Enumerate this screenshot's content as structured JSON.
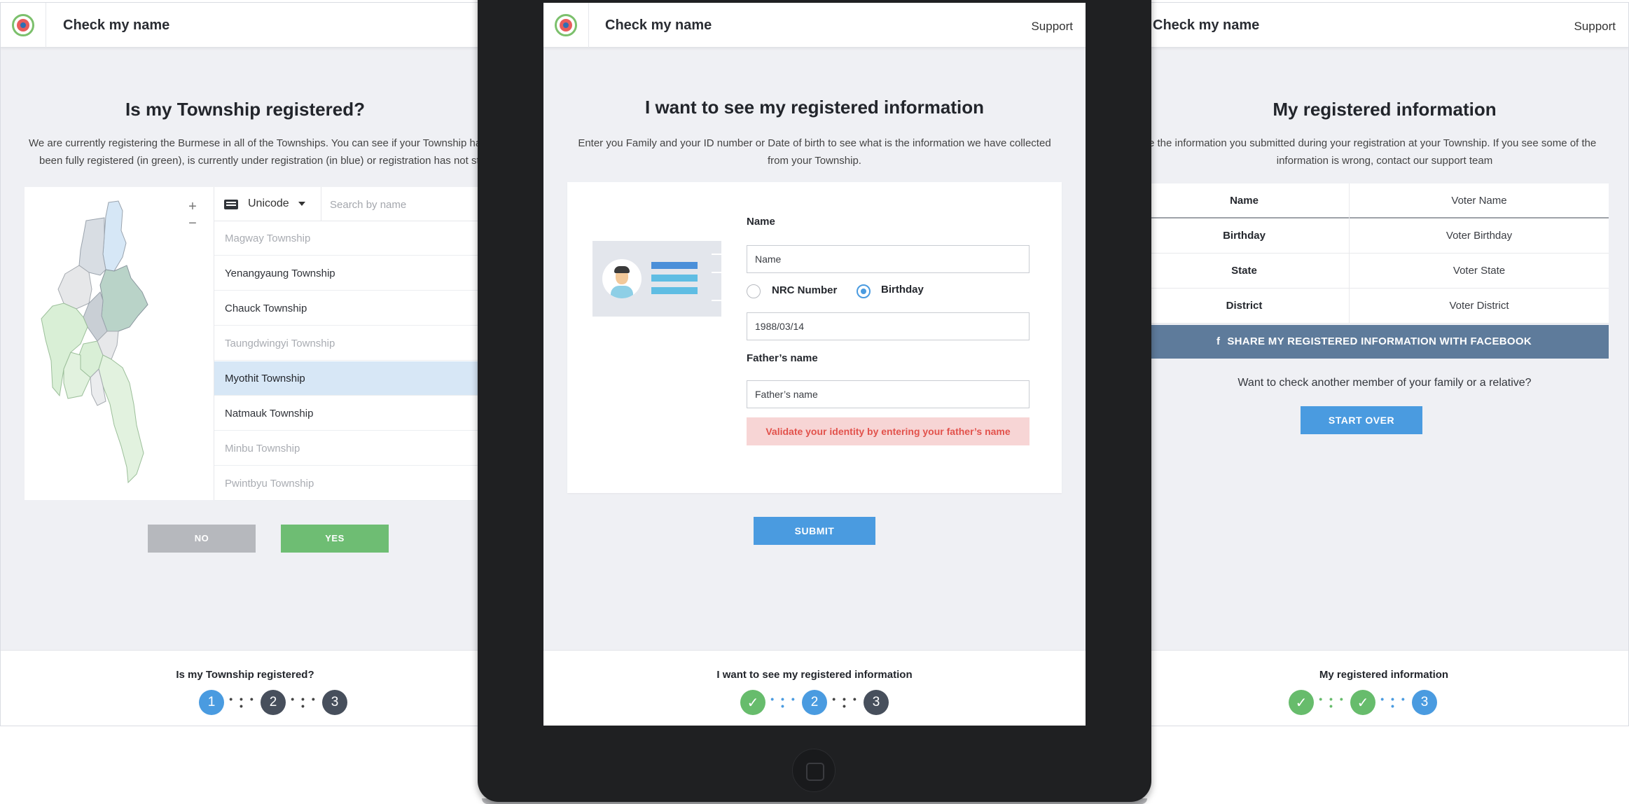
{
  "app": {
    "title": "Check my name",
    "support": "Support"
  },
  "screen1": {
    "heading": "Is my Township registered?",
    "description_line1": "We are currently registering the Burmese in all of the Townships. You can see if your Township has",
    "description_line2": "been fully registered (in green), is currently under registration (in blue) or registration has not star",
    "keyboard_icon": "keyboard-icon",
    "keyboard_select": "Unicode",
    "search_placeholder": "Search by name",
    "zoom_in": "+",
    "zoom_out": "−",
    "townships": [
      {
        "name": "Magway Township",
        "state": "muted"
      },
      {
        "name": "Yenangyaung Township",
        "state": "normal"
      },
      {
        "name": "Chauck Township",
        "state": "normal"
      },
      {
        "name": "Taungdwingyi Township",
        "state": "muted"
      },
      {
        "name": "Myothit Township",
        "state": "selected"
      },
      {
        "name": "Natmauk Township",
        "state": "normal"
      },
      {
        "name": "Minbu Township",
        "state": "muted"
      },
      {
        "name": "Pwintbyu Township",
        "state": "muted"
      }
    ],
    "no_label": "NO",
    "yes_label": "YES",
    "footer_title": "Is my Township registered?",
    "steps": [
      "1",
      "2",
      "3"
    ]
  },
  "screen2": {
    "heading": "I want to see my registered information",
    "description_line1": "Enter you Family and your ID number or Date of birth to see what is the information we have collected",
    "description_line2": "from your Township.",
    "name_label": "Name",
    "name_placeholder": "Name",
    "radio_nrc": "NRC Number",
    "radio_birthday": "Birthday",
    "selected_radio": "Birthday",
    "birthday_value": "1988/03/14",
    "father_label": "Father’s name",
    "father_placeholder": "Father’s name",
    "error_message": "Validate your identity by entering your father’s name",
    "submit_label": "SUBMIT",
    "footer_title": "I want to see my registered information",
    "steps": [
      "✓",
      "2",
      "3"
    ]
  },
  "screen3": {
    "heading": "My registered information",
    "description_line1": "re the information you submitted during your registration at your Township. If you see some of the",
    "description_line2": "information is wrong, contact our support team",
    "table": [
      {
        "field": "Name",
        "value": "Voter Name"
      },
      {
        "field": "Birthday",
        "value": "Voter Birthday"
      },
      {
        "field": "State",
        "value": "Voter State"
      },
      {
        "field": "District",
        "value": "Voter District"
      }
    ],
    "facebook_icon": "f",
    "facebook_label": "SHARE MY REGISTERED INFORMATION WITH FACEBOOK",
    "another_prompt": "Want to check another member of your family or a relative?",
    "start_over_label": "START OVER",
    "footer_title": "My registered information",
    "steps": [
      "✓",
      "✓",
      "3"
    ]
  },
  "colors": {
    "accent_blue": "#4a9be0",
    "success_green": "#67bc6c",
    "step_dark": "#474f5c",
    "error_red": "#e2524c",
    "facebook_blue": "#5e7b9b",
    "page_bg": "#eff0f4"
  }
}
